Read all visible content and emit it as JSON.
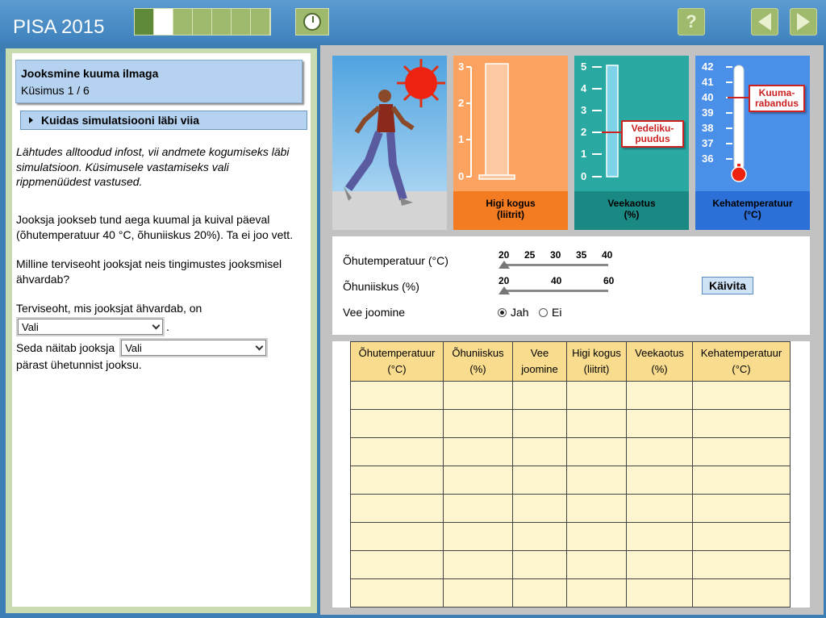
{
  "header": {
    "app_title": "PISA 2015",
    "progress": {
      "total": 7,
      "completed": 1,
      "current": 2
    }
  },
  "question": {
    "title": "Jooksmine kuuma ilmaga",
    "number": "Küsimus 1 / 6",
    "how_to": "Kuidas simulatsiooni läbi viia",
    "intro": "Lähtudes alltoodud infost, vii andmete kogumiseks läbi simulatsioon. Küsimusele vastamiseks vali rippmenüüdest vastused.",
    "scenario": "Jooksja jookseb tund aega kuumal ja kuival päeval (õhutemperatuur 40 °C, õhuniiskus 20%). Ta ei joo vett.",
    "prompt": "Milline terviseoht jooksjat neis tingimustes jooksmisel ähvardab?",
    "answer1_label": "Terviseoht, mis jooksjat ähvardab, on",
    "answer1_value": "Vali",
    "answer1_suffix": ".",
    "answer2_label": "Seda näitab jooksja",
    "answer2_value": "Vali",
    "answer2_suffix": "pärast ühetunnist jooksu."
  },
  "gauges": {
    "sweat": {
      "label_line1": "Higi kogus",
      "label_line2": "(liitrit)",
      "ticks": [
        "3",
        "2",
        "1",
        "0"
      ]
    },
    "water": {
      "label_line1": "Veekaotus",
      "label_line2": "(%)",
      "ticks": [
        "5",
        "4",
        "3",
        "2",
        "1",
        "0"
      ],
      "callout_line1": "Vedeliku-",
      "callout_line2": "puudus"
    },
    "body": {
      "label_line1": "Kehatemperatuur",
      "label_line2": "(°C)",
      "ticks": [
        "42",
        "41",
        "40",
        "39",
        "38",
        "37",
        "36"
      ],
      "callout_line1": "Kuuma-",
      "callout_line2": "rabandus"
    }
  },
  "controls": {
    "air_temp_label": "Õhutemperatuur (°C)",
    "air_temp_ticks": [
      "20",
      "25",
      "30",
      "35",
      "40"
    ],
    "air_temp_value": 20,
    "humidity_label": "Õhuniiskus (%)",
    "humidity_ticks": [
      "20",
      "40",
      "60"
    ],
    "humidity_value": 20,
    "drinking_label": "Vee joomine",
    "drinking_yes": "Jah",
    "drinking_no": "Ei",
    "drinking_selected": "Jah",
    "run_button": "Käivita"
  },
  "table": {
    "headers": [
      {
        "l1": "Õhutemperatuur",
        "l2": "(°C)"
      },
      {
        "l1": "Õhuniiskus",
        "l2": "(%)"
      },
      {
        "l1": "Vee",
        "l2": "joomine"
      },
      {
        "l1": "Higi kogus",
        "l2": "(liitrit)"
      },
      {
        "l1": "Veekaotus",
        "l2": "(%)"
      },
      {
        "l1": "Kehatemperatuur",
        "l2": "(°C)"
      }
    ],
    "row_count": 8
  },
  "colors": {
    "header_bg": "#4a8cc6",
    "progress_done": "#5f8a3a",
    "sweat_panel": "#fca361",
    "water_panel": "#2aa9a3",
    "body_panel": "#4a8fe8",
    "table_header": "#f9dc8d",
    "table_cell": "#fdf5d0",
    "callout_red": "#cc2222"
  }
}
